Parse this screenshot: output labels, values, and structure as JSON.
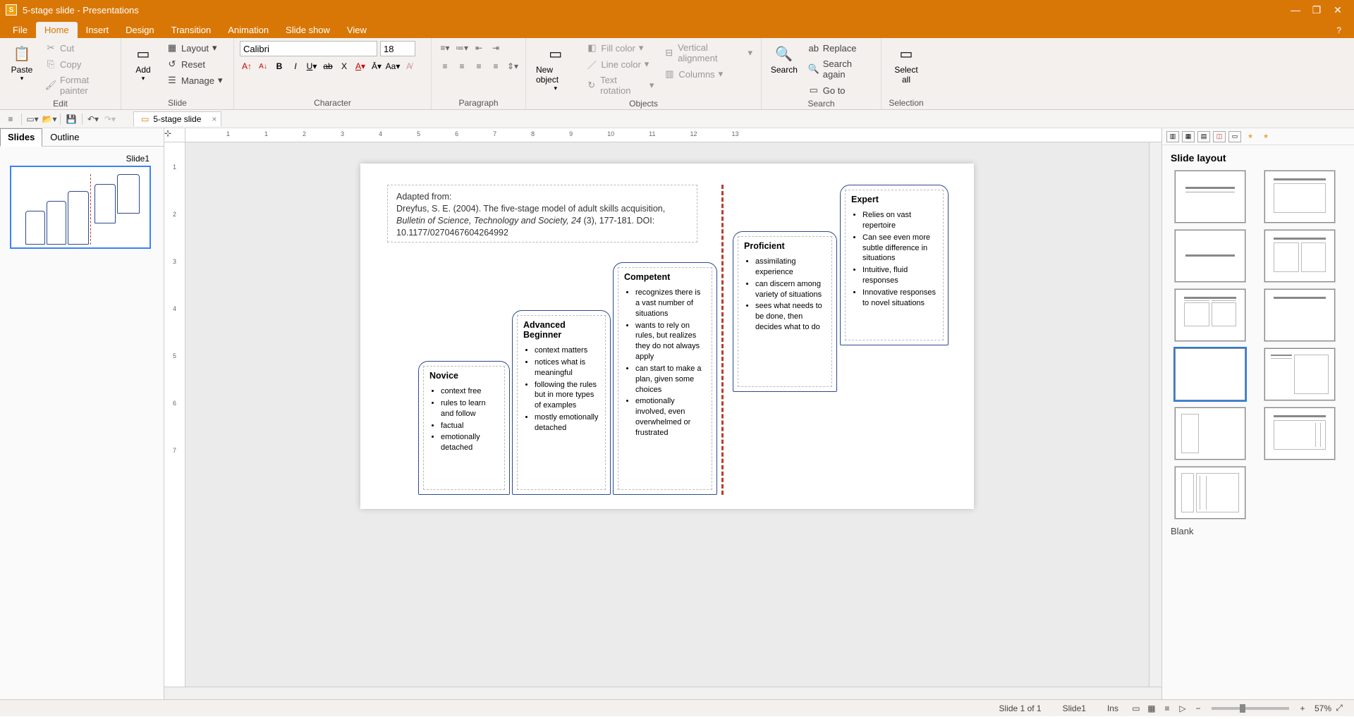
{
  "titlebar": {
    "doc_name": "5-stage slide",
    "app_name": "Presentations"
  },
  "menu": {
    "file": "File",
    "home": "Home",
    "insert": "Insert",
    "design": "Design",
    "transition": "Transition",
    "animation": "Animation",
    "slideshow": "Slide show",
    "view": "View",
    "help": "?"
  },
  "ribbon": {
    "edit": {
      "paste": "Paste",
      "cut": "Cut",
      "copy": "Copy",
      "format_painter": "Format painter",
      "group": "Edit"
    },
    "slide": {
      "add": "Add",
      "layout": "Layout",
      "reset": "Reset",
      "manage": "Manage",
      "group": "Slide"
    },
    "character": {
      "font": "Calibri",
      "size": "18",
      "group": "Character"
    },
    "paragraph": {
      "group": "Paragraph"
    },
    "objects": {
      "new_object": "New object",
      "fill": "Fill color",
      "line": "Line color",
      "rotation": "Text rotation",
      "valign": "Vertical alignment",
      "columns": "Columns",
      "group": "Objects"
    },
    "search": {
      "search": "Search",
      "replace": "Replace",
      "search_again": "Search again",
      "goto": "Go to",
      "group": "Search"
    },
    "selection": {
      "select_all": "Select all",
      "group": "Selection"
    }
  },
  "doc_tab": {
    "name": "5-stage slide"
  },
  "left_panel": {
    "slides_tab": "Slides",
    "outline_tab": "Outline",
    "thumb_label": "Slide1"
  },
  "ruler_h": [
    "1",
    "1",
    "2",
    "3",
    "4",
    "5",
    "6",
    "7",
    "8",
    "9",
    "10",
    "11",
    "12",
    "13"
  ],
  "ruler_v": [
    "1",
    "2",
    "3",
    "4",
    "5",
    "6",
    "7"
  ],
  "slide": {
    "citation_label": "Adapted from:",
    "citation_text1": "Dreyfus, S. E. (2004).  The five-stage model of adult skills acquisition,",
    "citation_text2_pre": "Bulletin of Science, Technology and Society, 24",
    "citation_text2_post": " (3), 177-181. DOI: 10.1177/0270467604264992",
    "stages": {
      "novice": {
        "title": "Novice",
        "items": [
          "context free",
          "rules to learn and follow",
          "factual",
          "emotionally detached"
        ]
      },
      "advanced": {
        "title": "Advanced Beginner",
        "items": [
          "context matters",
          "notices what is meaningful",
          "following the rules but in more types of examples",
          "mostly emotionally detached"
        ]
      },
      "competent": {
        "title": "Competent",
        "items": [
          "recognizes there is a vast number of situations",
          "wants to rely on rules, but realizes they do not always apply",
          "can start to make a plan, given some choices",
          "emotionally involved, even overwhelmed or frustrated"
        ]
      },
      "proficient": {
        "title": "Proficient",
        "items": [
          "assimilating experience",
          "can discern among variety of situations",
          "sees what needs to be done, then decides what to do"
        ]
      },
      "expert": {
        "title": "Expert",
        "items": [
          "Relies on vast repertoire",
          "Can see even more subtle difference in situations",
          "Intuitive, fluid responses",
          "Innovative responses to novel situations"
        ]
      }
    }
  },
  "right_panel": {
    "title": "Slide layout",
    "caption": "Blank"
  },
  "status": {
    "slide_pos": "Slide 1 of 1",
    "slide_name": "Slide1",
    "ins": "Ins",
    "zoom": "57%"
  }
}
